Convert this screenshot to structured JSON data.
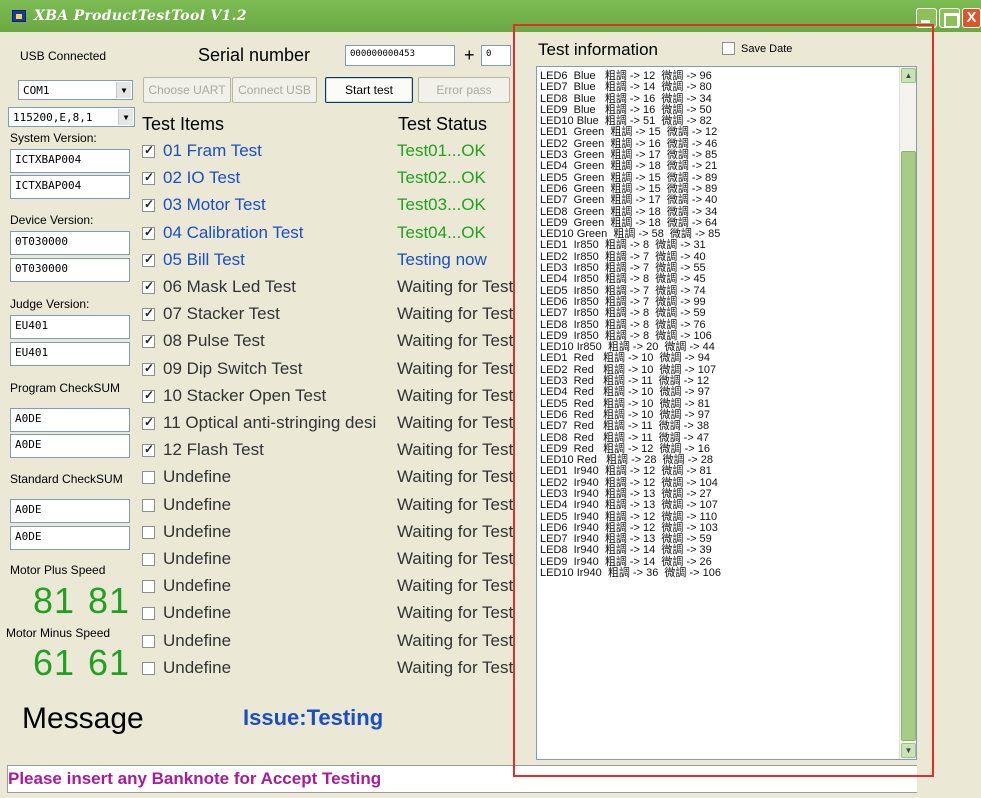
{
  "window": {
    "title": "XBA ProductTestTool V1.2",
    "close_glyph": "X"
  },
  "connection": {
    "status": "USB Connected",
    "port": "COM1",
    "baud": "115200,E,8,1"
  },
  "serial": {
    "label": "Serial number",
    "value": "000000000453",
    "plus_label": "+",
    "increment": "0"
  },
  "buttons": {
    "choose_uart": "Choose UART",
    "connect_usb": "Connect USB",
    "start_test": "Start test",
    "error_pass": "Error pass"
  },
  "versions": {
    "system_label": "System Version:",
    "system_1": "ICTXBAP004",
    "system_2": "ICTXBAP004",
    "device_label": "Device Version:",
    "device_1": "0T030000",
    "device_2": "0T030000",
    "judge_label": "Judge Version:",
    "judge_1": "EU401",
    "judge_2": "EU401",
    "program_label": "Program CheckSUM",
    "program_1": "A0DE",
    "program_2": "A0DE",
    "standard_label": "Standard CheckSUM",
    "standard_1": "A0DE",
    "standard_2": "A0DE"
  },
  "motor": {
    "plus_label": "Motor Plus Speed",
    "plus_1": "81",
    "plus_2": "81",
    "minus_label": "Motor Minus Speed",
    "minus_1": "61",
    "minus_2": "61"
  },
  "tests": {
    "items_header": "Test Items",
    "status_header": "Test Status",
    "rows": [
      {
        "label": "01 Fram Test",
        "checked": true,
        "status": "Test01...OK",
        "label_color": "#1a4fc4",
        "status_color": "#22a022"
      },
      {
        "label": "02 IO Test",
        "checked": true,
        "status": "Test02...OK",
        "label_color": "#1a4fc4",
        "status_color": "#22a022"
      },
      {
        "label": "03 Motor Test",
        "checked": true,
        "status": "Test03...OK",
        "label_color": "#1a4fc4",
        "status_color": "#22a022"
      },
      {
        "label": "04 Calibration Test",
        "checked": true,
        "status": "Test04...OK",
        "label_color": "#1a4fc4",
        "status_color": "#22a022"
      },
      {
        "label": "05 Bill Test",
        "checked": true,
        "status": "Testing now",
        "label_color": "#1a4fc4",
        "status_color": "#1a4fc4"
      },
      {
        "label": "06 Mask Led Test",
        "checked": true,
        "status": "Waiting for Test",
        "label_color": "#333333",
        "status_color": "#333333"
      },
      {
        "label": "07 Stacker Test",
        "checked": true,
        "status": "Waiting for Test",
        "label_color": "#333333",
        "status_color": "#333333"
      },
      {
        "label": "08 Pulse Test",
        "checked": true,
        "status": "Waiting for Test",
        "label_color": "#333333",
        "status_color": "#333333"
      },
      {
        "label": "09 Dip Switch Test",
        "checked": true,
        "status": "Waiting for Test",
        "label_color": "#333333",
        "status_color": "#333333"
      },
      {
        "label": "10 Stacker Open Test",
        "checked": true,
        "status": "Waiting for Test",
        "label_color": "#333333",
        "status_color": "#333333"
      },
      {
        "label": "11 Optical anti-stringing desi",
        "checked": true,
        "status": "Waiting for Test",
        "label_color": "#333333",
        "status_color": "#333333"
      },
      {
        "label": "12 Flash Test",
        "checked": true,
        "status": "Waiting for Test",
        "label_color": "#333333",
        "status_color": "#333333"
      },
      {
        "label": "Undefine",
        "checked": false,
        "status": "Waiting for Test",
        "label_color": "#333333",
        "status_color": "#333333"
      },
      {
        "label": "Undefine",
        "checked": false,
        "status": "Waiting for Test",
        "label_color": "#333333",
        "status_color": "#333333"
      },
      {
        "label": "Undefine",
        "checked": false,
        "status": "Waiting for Test",
        "label_color": "#333333",
        "status_color": "#333333"
      },
      {
        "label": "Undefine",
        "checked": false,
        "status": "Waiting for Test",
        "label_color": "#333333",
        "status_color": "#333333"
      },
      {
        "label": "Undefine",
        "checked": false,
        "status": "Waiting for Test",
        "label_color": "#333333",
        "status_color": "#333333"
      },
      {
        "label": "Undefine",
        "checked": false,
        "status": "Waiting for Test",
        "label_color": "#333333",
        "status_color": "#333333"
      },
      {
        "label": "Undefine",
        "checked": false,
        "status": "Waiting for Test",
        "label_color": "#333333",
        "status_color": "#333333"
      },
      {
        "label": "Undefine",
        "checked": false,
        "status": "Waiting for Test",
        "label_color": "#333333",
        "status_color": "#333333"
      }
    ]
  },
  "message": {
    "title": "Message",
    "issue": "Issue:Testing"
  },
  "status_bar": {
    "text": "Please insert any Banknote for Accept Testing"
  },
  "info": {
    "title": "Test information",
    "save_date_label": "Save Date",
    "save_date_checked": false,
    "lines": [
      "LED6  Blue   粗調 -> 12  微調 -> 96",
      "LED7  Blue   粗調 -> 14  微調 -> 80",
      "LED8  Blue   粗調 -> 16  微調 -> 34",
      "LED9  Blue   粗調 -> 16  微調 -> 50",
      "LED10 Blue  粗調 -> 51  微調 -> 82",
      "LED1  Green  粗調 -> 15  微調 -> 12",
      "LED2  Green  粗調 -> 16  微調 -> 46",
      "LED3  Green  粗調 -> 17  微調 -> 85",
      "LED4  Green  粗調 -> 18  微調 -> 21",
      "LED5  Green  粗調 -> 15  微調 -> 89",
      "LED6  Green  粗調 -> 15  微調 -> 89",
      "LED7  Green  粗調 -> 17  微調 -> 40",
      "LED8  Green  粗調 -> 18  微調 -> 34",
      "LED9  Green  粗調 -> 18  微調 -> 64",
      "LED10 Green  粗調 -> 58  微調 -> 85",
      "LED1  Ir850  粗調 -> 8  微調 -> 31",
      "LED2  Ir850  粗調 -> 7  微調 -> 40",
      "LED3  Ir850  粗調 -> 7  微調 -> 55",
      "LED4  Ir850  粗調 -> 8  微調 -> 45",
      "LED5  Ir850  粗調 -> 7  微調 -> 74",
      "LED6  Ir850  粗調 -> 7  微調 -> 99",
      "LED7  Ir850  粗調 -> 8  微調 -> 59",
      "LED8  Ir850  粗調 -> 8  微調 -> 76",
      "LED9  Ir850  粗調 -> 8  微調 -> 106",
      "LED10 Ir850  粗調 -> 20  微調 -> 44",
      "LED1  Red   粗調 -> 10  微調 -> 94",
      "LED2  Red   粗調 -> 10  微調 -> 107",
      "LED3  Red   粗調 -> 11  微調 -> 12",
      "LED4  Red   粗調 -> 10  微調 -> 97",
      "LED5  Red   粗調 -> 10  微調 -> 81",
      "LED6  Red   粗調 -> 10  微調 -> 97",
      "LED7  Red   粗調 -> 11  微調 -> 38",
      "LED8  Red   粗調 -> 11  微調 -> 47",
      "LED9  Red   粗調 -> 12  微調 -> 16",
      "LED10 Red   粗調 -> 28  微調 -> 28",
      "LED1  Ir940  粗調 -> 12  微調 -> 81",
      "LED2  Ir940  粗調 -> 12  微調 -> 104",
      "LED3  Ir940  粗調 -> 13  微調 -> 27",
      "LED4  Ir940  粗調 -> 13  微調 -> 107",
      "LED5  Ir940  粗調 -> 12  微調 -> 110",
      "LED6  Ir940  粗調 -> 12  微調 -> 103",
      "LED7  Ir940  粗調 -> 13  微調 -> 59",
      "LED8  Ir940  粗調 -> 14  微調 -> 39",
      "LED9  Ir940  粗調 -> 14  微調 -> 26",
      "LED10 Ir940  粗調 -> 36  微調 -> 106"
    ]
  },
  "colors": {
    "titlebar": "#6aa843",
    "ok_green": "#22a022",
    "active_blue": "#1a4fc4",
    "status_magenta": "#aa1a9c",
    "highlight_red": "#e0302a"
  }
}
